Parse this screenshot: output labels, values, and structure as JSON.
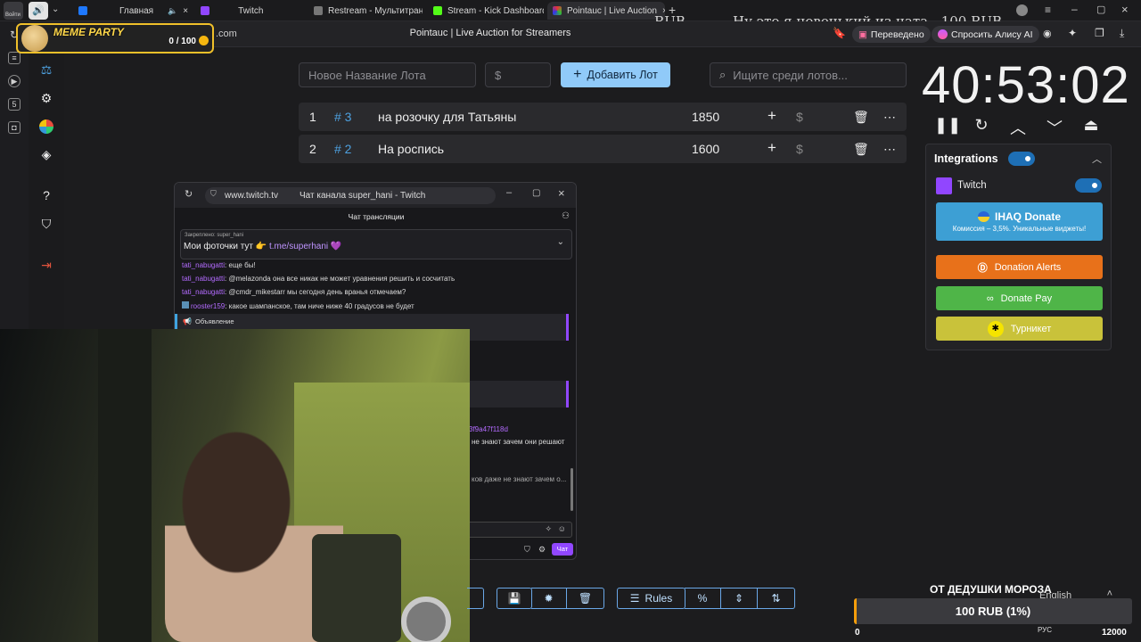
{
  "browser": {
    "tabs": [
      {
        "label": "Главная"
      },
      {
        "label": "Twitch"
      },
      {
        "label": "Restream - Мультитрансл"
      },
      {
        "label": "Stream - Kick Dashboard"
      },
      {
        "label": "Pointauc | Live Auction"
      }
    ],
    "login_label": "Войти",
    "address_domain": ".com",
    "page_title": "Pointauc | Live Auction for Streamers",
    "translated_label": "Переведено",
    "alice_label": "Спросить Алису AI"
  },
  "overlay": {
    "currency": "RUB",
    "message": "Ну это я новенький из чата - 100 RUB"
  },
  "meme_party": {
    "title": "MEME PARTY",
    "count": "0 / 100"
  },
  "auction": {
    "lot_name_placeholder": "Новое Название Лота",
    "amount_placeholder": "$",
    "add_button": "Добавить Лот",
    "search_placeholder": "Ищите среди лотов...",
    "lots": [
      {
        "index": "1",
        "hash": "# 3",
        "name": "на розочку для Татьяны",
        "amount": "1850"
      },
      {
        "index": "2",
        "hash": "# 2",
        "name": "На роспись",
        "amount": "1600"
      }
    ]
  },
  "timer": {
    "value": "40:53:02"
  },
  "integrations": {
    "title": "Integrations",
    "twitch_label": "Twitch",
    "ihaq_title": "IHAQ Donate",
    "ihaq_sub": "Комиссия – 3,5%. Уникальные виджеты!",
    "donation_alerts": "Donation Alerts",
    "donate_pay": "Donate Pay",
    "turniket": "Турникет",
    "colors": {
      "ihaq": "#3d9fd4",
      "donation_alerts": "#e8711a",
      "donate_pay": "#4fb548",
      "turniket": "#c9c23a"
    }
  },
  "chat": {
    "url": "www.twitch.tv",
    "window_title": "Чат канала super_hani - Twitch",
    "header": "Чат трансляции",
    "pinned_meta": "Закреплено: super_hani",
    "pinned_text": "Мои фоточки тут 👉 ",
    "pinned_link": "t.me/superhani 💜",
    "messages": [
      {
        "user": "tati_nabugatti",
        "text": ": еще бы!"
      },
      {
        "user": "tati_nabugatti",
        "text": ": @melazonda она все никак не может уравнения решить и сосчитать"
      },
      {
        "user": "tati_nabugatti",
        "text": ": @cmdr_mikestarr мы сегодня день вранья отмечаем?"
      },
      {
        "user": "rooster159",
        "text": ": какое шампанское, там ниче ниже 40 градусов не будет"
      }
    ],
    "announcement": "Объявление",
    "partial_1": "3f9a47f118d",
    "partial_2": "не знают зачем они решают",
    "partial_3": "ков даже не знают зачем о...",
    "chat_button": "Чат"
  },
  "toolbar": {
    "rules": "Rules"
  },
  "donation": {
    "goal_title": "ОТ ДЕДУШКИ МОРОЗА",
    "bar_text": "100 RUB (1%)",
    "min": "0",
    "max": "12000",
    "language": "English",
    "lang_indicator": "РУС"
  }
}
